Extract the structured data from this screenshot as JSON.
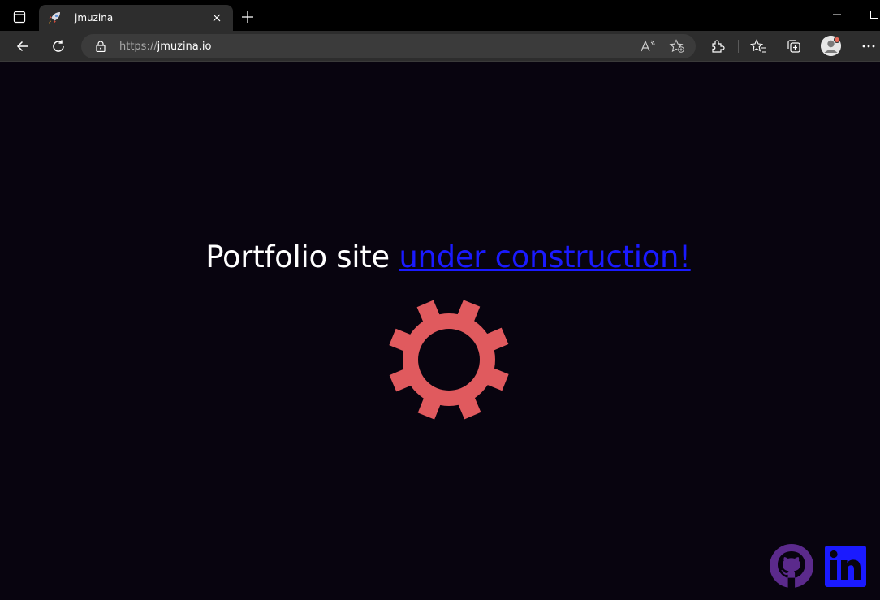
{
  "browser": {
    "tab": {
      "title": "jmuzina",
      "favicon": "rocket-icon"
    },
    "address_bar": {
      "scheme": "https://",
      "host": "jmuzina.io"
    },
    "toolbar_icons": [
      "back-icon",
      "refresh-icon",
      "read-aloud-icon",
      "add-favorite-icon",
      "extensions-icon",
      "favorites-icon",
      "collections-icon",
      "profile-avatar",
      "more-icon"
    ]
  },
  "page": {
    "headline": {
      "text": "Portfolio site ",
      "link_text": "under construction!"
    },
    "gear_color": "#e05a5e",
    "link_color": "#1a1aff",
    "background": "#08040f",
    "social": [
      {
        "name": "github",
        "icon": "github-icon",
        "color": "#5b2a8c"
      },
      {
        "name": "linkedin",
        "icon": "linkedin-icon",
        "color": "#1a1aff"
      }
    ]
  }
}
